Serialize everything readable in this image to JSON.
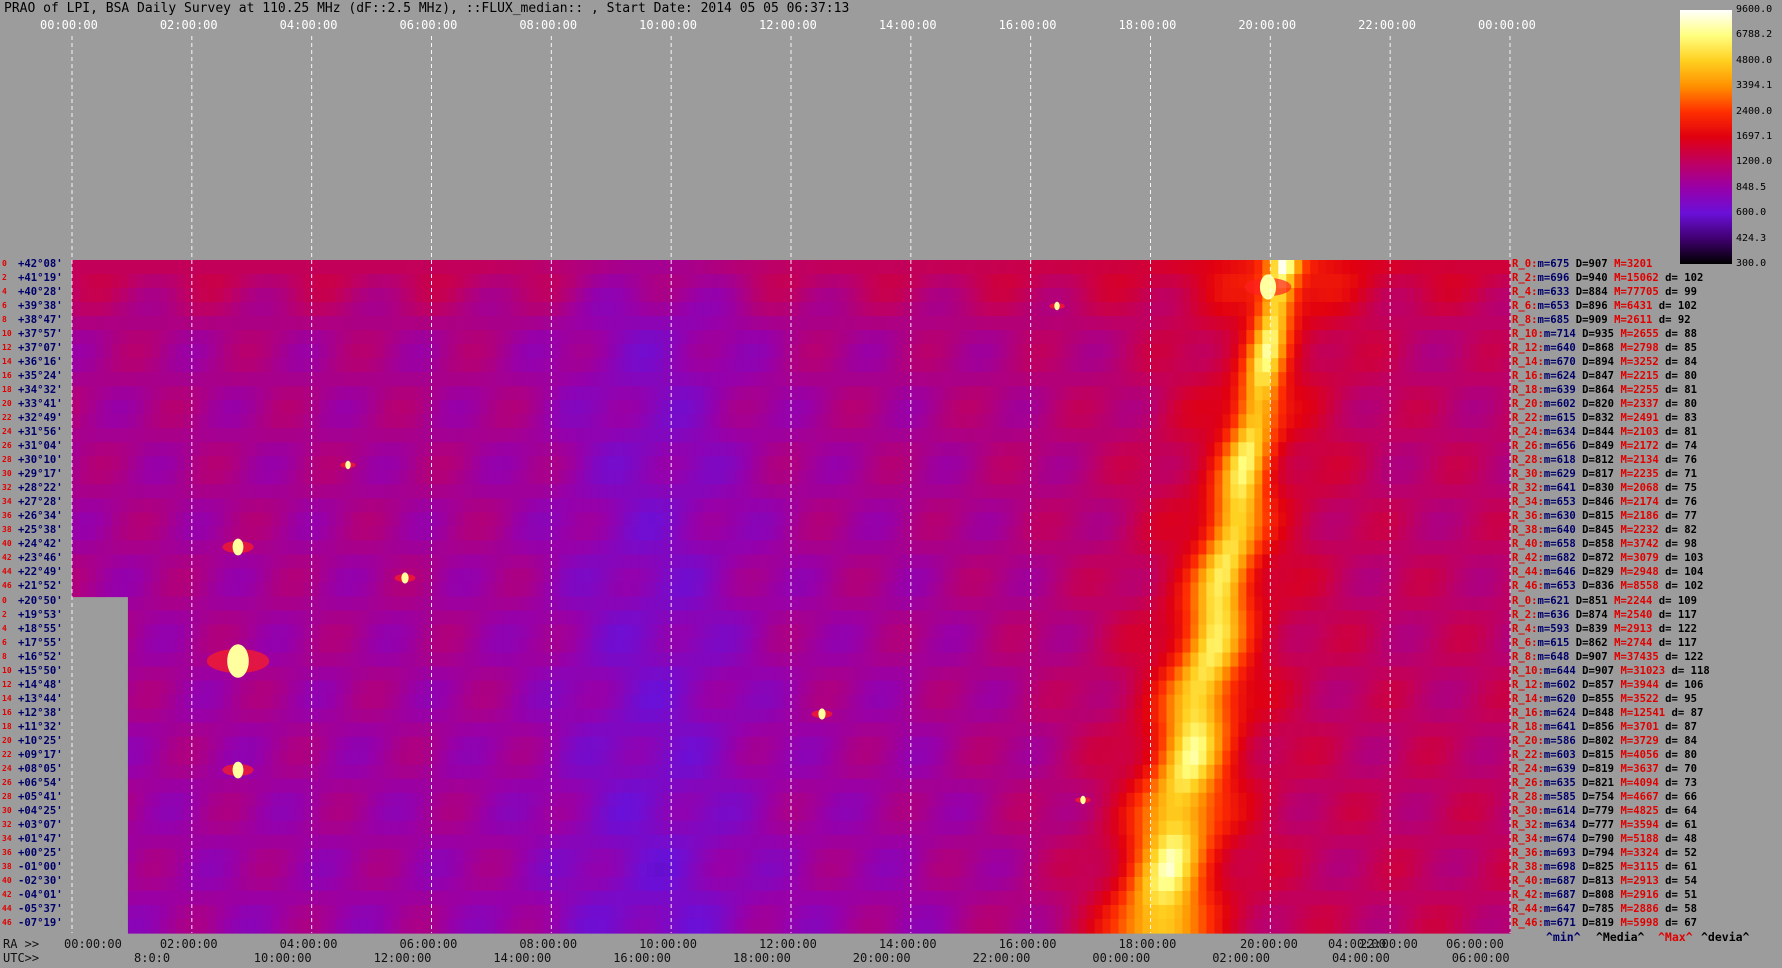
{
  "title": "PRAO of LPI, BSA Daily Survey at 110.25 MHz (dF::2.5 MHz), ::FLUX_median:: , Start Date: 2014 05 05 06:37:13",
  "chart_data": {
    "type": "heatmap",
    "top_axis_ticks": [
      "00:00:00",
      "02:00:00",
      "04:00:00",
      "06:00:00",
      "08:00:00",
      "10:00:00",
      "12:00:00",
      "14:00:00",
      "16:00:00",
      "18:00:00",
      "20:00:00",
      "22:00:00",
      "00:00:00"
    ],
    "ra_prefix": "RA >>",
    "ra_ticks": [
      "00:00:00",
      "02:00:00",
      "04:00:00",
      "06:00:00",
      "08:00:00",
      "10:00:00",
      "12:00:00",
      "14:00:00",
      "16:00:00",
      "18:00:00",
      "20:00:00",
      "04:00:00",
      "22:00:00",
      "06:00:00"
    ],
    "utc_prefix": "UTC>>",
    "utc_ticks": [
      "8:0:0",
      "10:0",
      "0:00",
      "12:0",
      "0:00",
      "14:0",
      "0:00",
      "16:0",
      "0:00",
      "18:0",
      "0:00",
      "20:0",
      "0:00",
      "22:0",
      "0:00",
      "00:0",
      "0:00",
      "02:0",
      "0:00",
      "04:0",
      "0:00",
      "06:0",
      "0:00"
    ],
    "utc_labels": [
      "8:0:0",
      "10:00:00",
      "12:00:00",
      "14:00:00",
      "16:00:00",
      "18:00:00",
      "20:00:00",
      "22:00:00",
      "00:00:00",
      "02:00:00",
      "04:00:00",
      "06:00:00"
    ],
    "colorbar": {
      "ticks": [
        "9600.0",
        "6788.2",
        "4800.0",
        "3394.1",
        "2400.0",
        "1697.1",
        "1200.0",
        "848.5",
        "600.0",
        "424.3",
        "300.0"
      ],
      "colors": [
        "#ffffff",
        "#ffff80",
        "#ffd020",
        "#ff9000",
        "#ff3000",
        "#e00010",
        "#c00060",
        "#9800a8",
        "#6a10d8",
        "#400070",
        "#000000"
      ]
    },
    "declinations": [
      "+42°08'",
      "+41°19'",
      "+40°28'",
      "+39°38'",
      "+38°47'",
      "+37°57'",
      "+37°07'",
      "+36°16'",
      "+35°24'",
      "+34°32'",
      "+33°41'",
      "+32°49'",
      "+31°56'",
      "+31°04'",
      "+30°10'",
      "+29°17'",
      "+28°22'",
      "+27°28'",
      "+26°34'",
      "+25°38'",
      "+24°42'",
      "+23°46'",
      "+22°49'",
      "+21°52'",
      "+20°50'",
      "+19°53'",
      "+18°55'",
      "+17°55'",
      "+16°52'",
      "+15°50'",
      "+14°48'",
      "+13°44'",
      "+12°38'",
      "+11°32'",
      "+10°25'",
      "+09°17'",
      "+08°05'",
      "+06°54'",
      "+05°41'",
      "+04°25'",
      "+03°07'",
      "+01°47'",
      "+00°25'",
      "-01°00'",
      "-02°30'",
      "-04°01'",
      "-05°37'",
      "-07°19'"
    ],
    "stats": [
      {
        "name": "R_0:",
        "m": "m=675",
        "D": "D=907",
        "M": "M=3201",
        "d": ""
      },
      {
        "name": "R_2:",
        "m": "m=696",
        "D": "D=940",
        "M": "M=15062",
        "d": "d= 102"
      },
      {
        "name": "R_4:",
        "m": "m=633",
        "D": "D=884",
        "M": "M=77705",
        "d": "d= 99"
      },
      {
        "name": "R_6:",
        "m": "m=653",
        "D": "D=896",
        "M": "M=6431",
        "d": "d= 102"
      },
      {
        "name": "R_8:",
        "m": "m=685",
        "D": "D=909",
        "M": "M=2611",
        "d": "d= 92"
      },
      {
        "name": "R_10:",
        "m": "m=714",
        "D": "D=935",
        "M": "M=2655",
        "d": "d= 88"
      },
      {
        "name": "R_12:",
        "m": "m=640",
        "D": "D=868",
        "M": "M=2798",
        "d": "d= 85"
      },
      {
        "name": "R_14:",
        "m": "m=670",
        "D": "D=894",
        "M": "M=3252",
        "d": "d= 84"
      },
      {
        "name": "R_16:",
        "m": "m=624",
        "D": "D=847",
        "M": "M=2215",
        "d": "d= 80"
      },
      {
        "name": "R_18:",
        "m": "m=639",
        "D": "D=864",
        "M": "M=2255",
        "d": "d= 81"
      },
      {
        "name": "R_20:",
        "m": "m=602",
        "D": "D=820",
        "M": "M=2337",
        "d": "d= 80"
      },
      {
        "name": "R_22:",
        "m": "m=615",
        "D": "D=832",
        "M": "M=2491",
        "d": "d= 83"
      },
      {
        "name": "R_24:",
        "m": "m=634",
        "D": "D=844",
        "M": "M=2103",
        "d": "d= 81"
      },
      {
        "name": "R_26:",
        "m": "m=656",
        "D": "D=849",
        "M": "M=2172",
        "d": "d= 74"
      },
      {
        "name": "R_28:",
        "m": "m=618",
        "D": "D=812",
        "M": "M=2134",
        "d": "d= 76"
      },
      {
        "name": "R_30:",
        "m": "m=629",
        "D": "D=817",
        "M": "M=2235",
        "d": "d= 71"
      },
      {
        "name": "R_32:",
        "m": "m=641",
        "D": "D=830",
        "M": "M=2068",
        "d": "d= 75"
      },
      {
        "name": "R_34:",
        "m": "m=653",
        "D": "D=846",
        "M": "M=2174",
        "d": "d= 76"
      },
      {
        "name": "R_36:",
        "m": "m=630",
        "D": "D=815",
        "M": "M=2186",
        "d": "d= 77"
      },
      {
        "name": "R_38:",
        "m": "m=640",
        "D": "D=845",
        "M": "M=2232",
        "d": "d= 82"
      },
      {
        "name": "R_40:",
        "m": "m=658",
        "D": "D=858",
        "M": "M=3742",
        "d": "d= 98"
      },
      {
        "name": "R_42:",
        "m": "m=682",
        "D": "D=872",
        "M": "M=3079",
        "d": "d= 103"
      },
      {
        "name": "R_44:",
        "m": "m=646",
        "D": "D=829",
        "M": "M=2948",
        "d": "d= 104"
      },
      {
        "name": "R_46:",
        "m": "m=653",
        "D": "D=836",
        "M": "M=8558",
        "d": "d= 102"
      },
      {
        "name": "R_0:",
        "m": "m=621",
        "D": "D=851",
        "M": "M=2244",
        "d": "d= 109"
      },
      {
        "name": "R_2:",
        "m": "m=636",
        "D": "D=874",
        "M": "M=2540",
        "d": "d= 117"
      },
      {
        "name": "R_4:",
        "m": "m=593",
        "D": "D=839",
        "M": "M=2913",
        "d": "d= 122"
      },
      {
        "name": "R_6:",
        "m": "m=615",
        "D": "D=862",
        "M": "M=2744",
        "d": "d= 117"
      },
      {
        "name": "R_8:",
        "m": "m=648",
        "D": "D=907",
        "M": "M=37435",
        "d": "d= 122"
      },
      {
        "name": "R_10:",
        "m": "m=644",
        "D": "D=907",
        "M": "M=31023",
        "d": "d= 118"
      },
      {
        "name": "R_12:",
        "m": "m=602",
        "D": "D=857",
        "M": "M=3944",
        "d": "d= 106"
      },
      {
        "name": "R_14:",
        "m": "m=620",
        "D": "D=855",
        "M": "M=3522",
        "d": "d= 95"
      },
      {
        "name": "R_16:",
        "m": "m=624",
        "D": "D=848",
        "M": "M=12541",
        "d": "d= 87"
      },
      {
        "name": "R_18:",
        "m": "m=641",
        "D": "D=856",
        "M": "M=3701",
        "d": "d= 87"
      },
      {
        "name": "R_20:",
        "m": "m=586",
        "D": "D=802",
        "M": "M=3729",
        "d": "d= 84"
      },
      {
        "name": "R_22:",
        "m": "m=603",
        "D": "D=815",
        "M": "M=4056",
        "d": "d= 80"
      },
      {
        "name": "R_24:",
        "m": "m=639",
        "D": "D=819",
        "M": "M=3637",
        "d": "d= 70"
      },
      {
        "name": "R_26:",
        "m": "m=635",
        "D": "D=821",
        "M": "M=4094",
        "d": "d= 73"
      },
      {
        "name": "R_28:",
        "m": "m=585",
        "D": "D=754",
        "M": "M=4667",
        "d": "d= 66"
      },
      {
        "name": "R_30:",
        "m": "m=614",
        "D": "D=779",
        "M": "M=4825",
        "d": "d= 64"
      },
      {
        "name": "R_32:",
        "m": "m=634",
        "D": "D=777",
        "M": "M=3594",
        "d": "d= 61"
      },
      {
        "name": "R_34:",
        "m": "m=674",
        "D": "D=790",
        "M": "M=5188",
        "d": "d= 48"
      },
      {
        "name": "R_36:",
        "m": "m=693",
        "D": "D=794",
        "M": "M=3324",
        "d": "d= 52"
      },
      {
        "name": "R_38:",
        "m": "m=698",
        "D": "D=825",
        "M": "M=3115",
        "d": "d= 61"
      },
      {
        "name": "R_40:",
        "m": "m=687",
        "D": "D=813",
        "M": "M=2913",
        "d": "d= 54"
      },
      {
        "name": "R_42:",
        "m": "m=687",
        "D": "D=808",
        "M": "M=2916",
        "d": "d= 51"
      },
      {
        "name": "R_44:",
        "m": "m=647",
        "D": "D=785",
        "M": "M=2886",
        "d": "d= 58"
      },
      {
        "name": "R_46:",
        "m": "m=671",
        "D": "D=819",
        "M": "M=5998",
        "d": "d= 67"
      }
    ],
    "legend": {
      "min": "^min^",
      "median": "^Media^",
      "max": "^Max^",
      "dev": "^devia^"
    }
  }
}
